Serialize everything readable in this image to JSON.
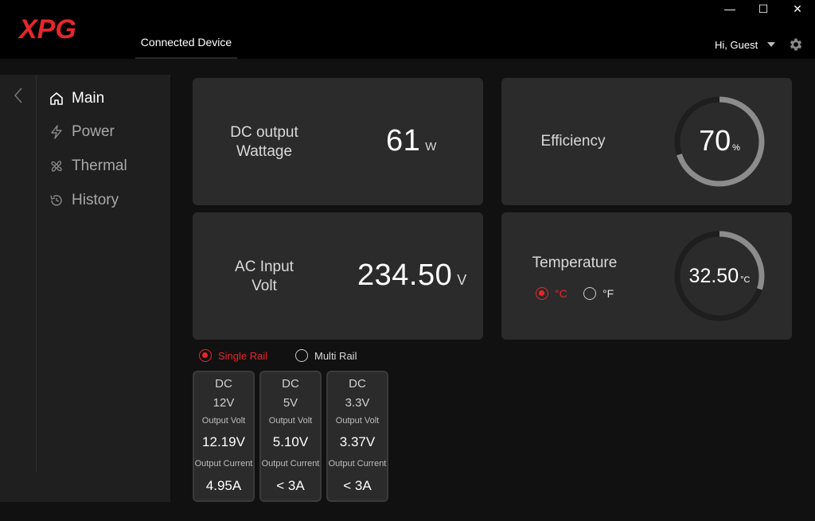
{
  "header": {
    "logo_text": "XPG",
    "tab_label": "Connected Device",
    "user_label": "Hi, Guest",
    "window_controls": {
      "minimize": "—",
      "maximize": "☐",
      "close": "✕"
    }
  },
  "sidebar": {
    "items": [
      {
        "label": "Main",
        "icon": "home-icon",
        "active": true
      },
      {
        "label": "Power",
        "icon": "lightning-icon",
        "active": false
      },
      {
        "label": "Thermal",
        "icon": "fan-icon",
        "active": false
      },
      {
        "label": "History",
        "icon": "clock-icon",
        "active": false
      }
    ]
  },
  "dc_output": {
    "label_line1": "DC output",
    "label_line2": "Wattage",
    "value": "61",
    "unit": "W"
  },
  "efficiency": {
    "label": "Efficiency",
    "value": "70",
    "unit": "%",
    "percent": 70
  },
  "ac_input": {
    "label_line1": "AC Input",
    "label_line2": "Volt",
    "value": "234.50",
    "unit": "V"
  },
  "temperature": {
    "label": "Temperature",
    "value": "32.50",
    "unit": "°C",
    "gauge_fraction": 0.3,
    "celsius_label": "°C",
    "fahrenheit_label": "°F",
    "selected": "celsius"
  },
  "rail_mode": {
    "single_label": "Single Rail",
    "multi_label": "Multi Rail",
    "selected": "single"
  },
  "rails": [
    {
      "type": "DC",
      "volt": "12V",
      "output_volt_label": "Output Volt",
      "output_volt": "12.19V",
      "output_current_label": "Output Current",
      "output_current": "4.95A"
    },
    {
      "type": "DC",
      "volt": "5V",
      "output_volt_label": "Output Volt",
      "output_volt": "5.10V",
      "output_current_label": "Output Current",
      "output_current": "< 3A"
    },
    {
      "type": "DC",
      "volt": "3.3V",
      "output_volt_label": "Output Volt",
      "output_volt": "3.37V",
      "output_current_label": "Output Current",
      "output_current": "< 3A"
    }
  ],
  "colors": {
    "accent": "#e8262b",
    "card": "#2b2b2b",
    "gauge_track": "#1e1e1e",
    "gauge_fill": "#8c8c8c"
  }
}
